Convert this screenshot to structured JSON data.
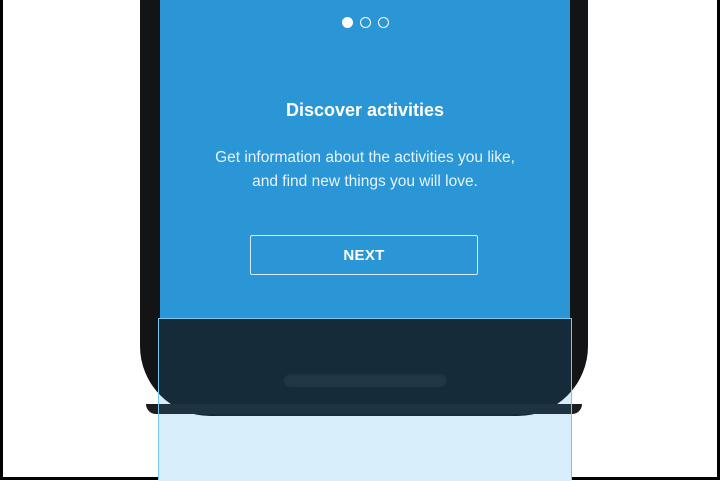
{
  "onboarding": {
    "pager": {
      "total": 3,
      "active_index": 0
    },
    "title": "Discover activities",
    "description_lines": [
      "Get information about the activities you like,",
      "and find new things you will love."
    ],
    "next_button_label": "NEXT"
  },
  "colors": {
    "screen_background": "#2a96d6",
    "device_body": "#121416",
    "highlight_border": "#79c7ee",
    "highlight_fill": "#d9eefb"
  }
}
